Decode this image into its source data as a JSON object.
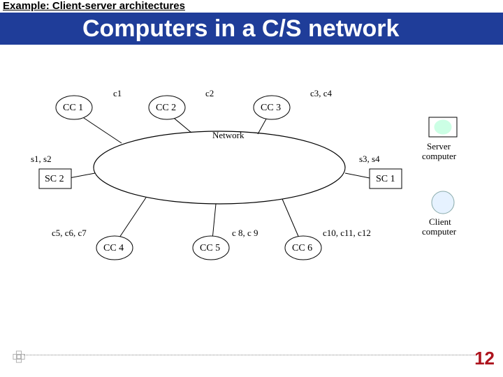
{
  "header": {
    "example_label": "Example: Client-server architectures",
    "title": "Computers in a C/S network"
  },
  "diagram": {
    "network_label": "Network",
    "nodes": {
      "cc1": {
        "box": "CC 1",
        "clients": "c1"
      },
      "cc2": {
        "box": "CC 2",
        "clients": "c2"
      },
      "cc3": {
        "box": "CC 3",
        "clients": "c3, c4"
      },
      "cc4": {
        "box": "CC 4",
        "clients": "c5, c6, c7"
      },
      "cc5": {
        "box": "CC 5",
        "clients": "c 8, c 9"
      },
      "cc6": {
        "box": "CC 6",
        "clients": "c10, c11, c12"
      },
      "sc1": {
        "box": "SC 1",
        "servers": "s3, s4"
      },
      "sc2": {
        "box": "SC 2",
        "servers": "s1, s2"
      }
    },
    "legend": {
      "server_label": "Server",
      "server_label2": "computer",
      "client_label": "Client",
      "client_label2": "computer"
    }
  },
  "footer": {
    "page_number": "12"
  }
}
